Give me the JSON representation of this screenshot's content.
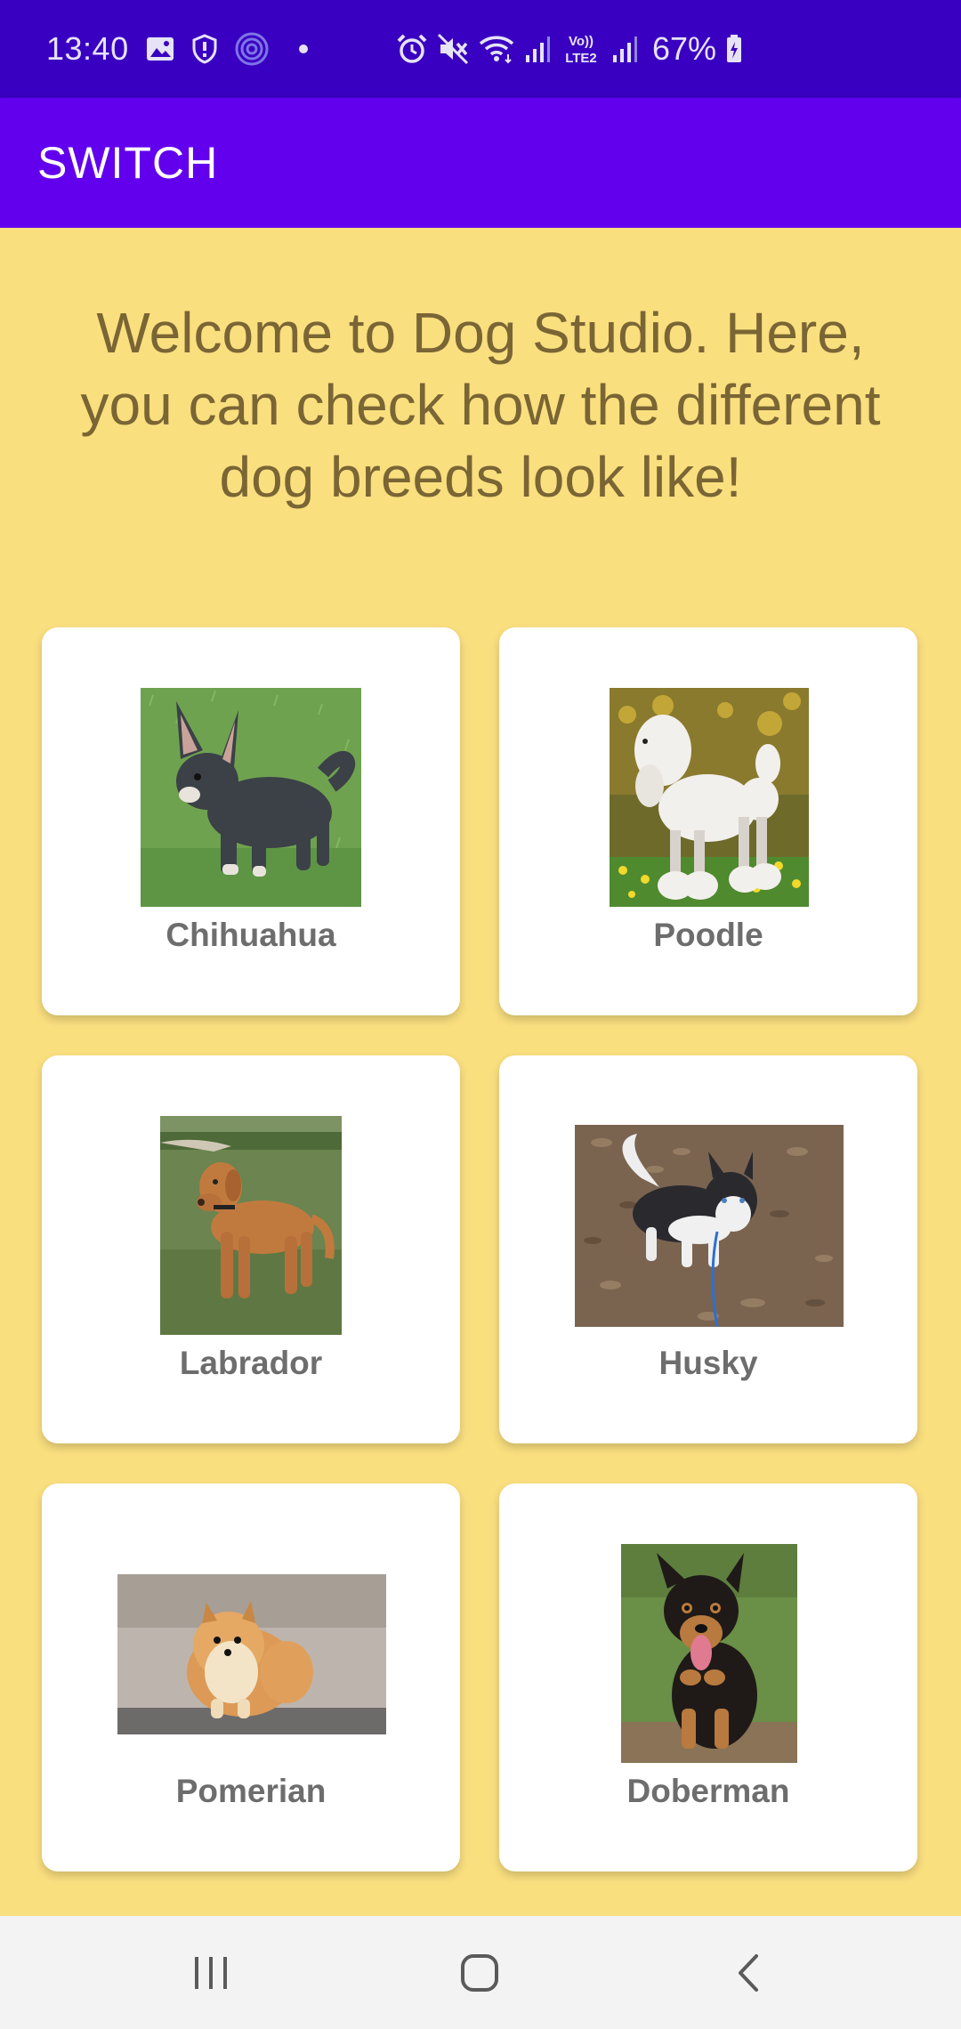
{
  "status_bar": {
    "time": "13:40",
    "battery": "67%",
    "network": "LTE2",
    "icons": [
      "gallery-icon",
      "shield-icon",
      "vpn-icon",
      "dot-icon",
      "alarm-icon",
      "mute-icon",
      "wifi-icon",
      "signal-icon",
      "volte-icon",
      "battery-icon"
    ]
  },
  "app_bar": {
    "title": "SWITCH"
  },
  "welcome_text": "Welcome to Dog Studio. Here, you can check how the different dog breeds look like!",
  "breeds": [
    {
      "name": "Chihuahua",
      "photo": "chihuahua-photo"
    },
    {
      "name": "Poodle",
      "photo": "poodle-photo"
    },
    {
      "name": "Labrador",
      "photo": "labrador-photo"
    },
    {
      "name": "Husky",
      "photo": "husky-photo"
    },
    {
      "name": "Pomerian",
      "photo": "pomeranian-photo"
    },
    {
      "name": "Doberman",
      "photo": "doberman-photo"
    }
  ],
  "nav_bar": {
    "buttons": [
      "recent-apps-icon",
      "home-icon",
      "back-icon"
    ]
  },
  "colors": {
    "status_bar": "#3a00c1",
    "app_bar": "#6200ee",
    "background": "#fadf7f",
    "welcome_text": "#7a6535",
    "label_text": "#6d6d6d"
  }
}
